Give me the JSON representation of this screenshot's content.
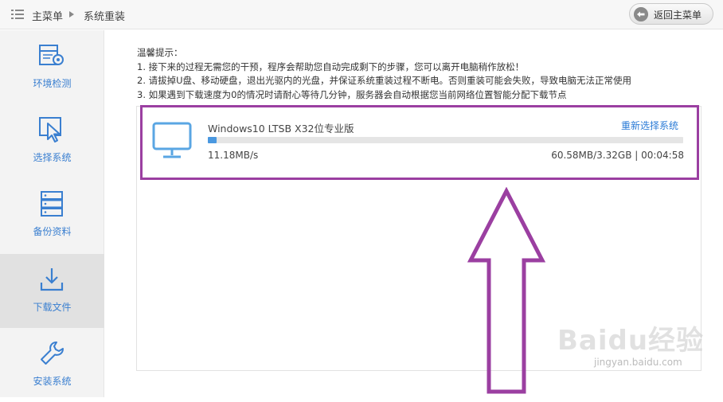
{
  "topbar": {
    "menu_icon": "list-icon",
    "breadcrumb_home": "主菜单",
    "breadcrumb_current": "系统重装",
    "back_button": "返回主菜单",
    "back_icon": "back-arrow-icon"
  },
  "sidebar": {
    "items": [
      {
        "label": "环境检测",
        "icon": "environment-check-icon",
        "active": false
      },
      {
        "label": "选择系统",
        "icon": "cursor-select-icon",
        "active": false
      },
      {
        "label": "备份资料",
        "icon": "server-backup-icon",
        "active": false
      },
      {
        "label": "下载文件",
        "icon": "download-icon",
        "active": true
      },
      {
        "label": "安装系统",
        "icon": "wrench-icon",
        "active": false
      }
    ]
  },
  "tips": {
    "title": "温馨提示：",
    "lines": [
      "1. 接下来的过程无需您的干预，程序会帮助您自动完成剩下的步骤，您可以离开电脑稍作放松！",
      "2. 请拔掉U盘、移动硬盘，退出光驱内的光盘，并保证系统重装过程不断电。否则重装可能会失败，导致电脑无法正常使用",
      "3. 如果遇到下载速度为0的情况时请耐心等待几分钟，服务器会自动根据您当前网络位置智能分配下载节点"
    ]
  },
  "download": {
    "icon": "monitor-icon",
    "title": "Windows10 LTSB X32位专业版",
    "reselect_link": "重新选择系统",
    "progress": 0.018,
    "speed": "11.18MB/s",
    "status": "60.58MB/3.32GB | 00:04:58"
  },
  "colors": {
    "accent": "#3a7fd0",
    "highlight": "#9b3fa1",
    "progress_fill": "#4a98e0"
  },
  "watermark": {
    "main": "Baidu经验",
    "sub": "jingyan.baidu.com"
  }
}
